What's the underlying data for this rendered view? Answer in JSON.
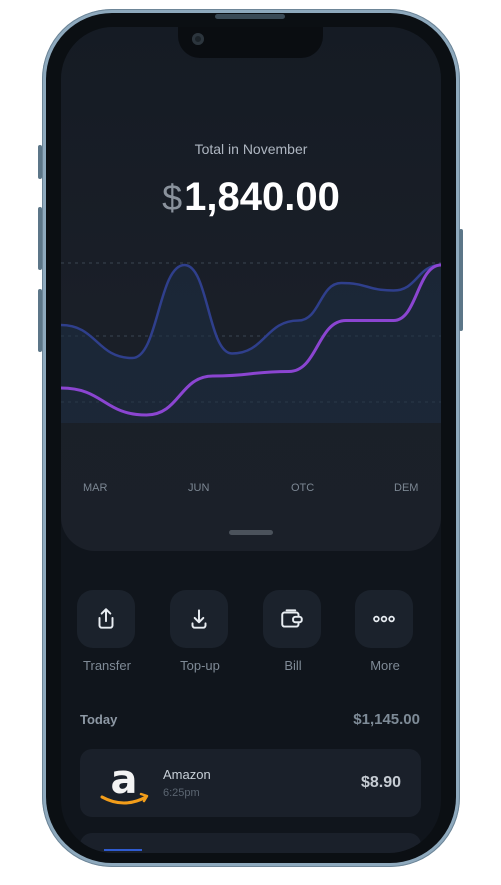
{
  "summary": {
    "label": "Total in November",
    "currency": "$",
    "amount": "1,840.00"
  },
  "chart_data": {
    "type": "line",
    "x_labels": [
      "MAR",
      "JUN",
      "OTC",
      "DEM"
    ],
    "series": [
      {
        "color": "#2f3f8c",
        "points": [
          {
            "x": 0,
            "y": 0.52
          },
          {
            "x": 1.5,
            "y": 0.3
          },
          {
            "x": 2.6,
            "y": 0.92
          },
          {
            "x": 3.6,
            "y": 0.33
          },
          {
            "x": 5.0,
            "y": 0.55
          },
          {
            "x": 5.9,
            "y": 0.8
          },
          {
            "x": 7.0,
            "y": 0.75
          },
          {
            "x": 8.0,
            "y": 0.92
          }
        ]
      },
      {
        "color": "#8b45d1",
        "points": [
          {
            "x": 0,
            "y": 0.1
          },
          {
            "x": 1.8,
            "y": -0.08
          },
          {
            "x": 3.2,
            "y": 0.18
          },
          {
            "x": 4.8,
            "y": 0.21
          },
          {
            "x": 6.0,
            "y": 0.55
          },
          {
            "x": 7.0,
            "y": 0.55
          },
          {
            "x": 8.0,
            "y": 0.92
          }
        ]
      }
    ],
    "colors": {
      "grid": "#3a4552",
      "area": "#1d2d44"
    }
  },
  "actions": [
    {
      "label": "Transfer",
      "icon": "share-up-icon"
    },
    {
      "label": "Top-up",
      "icon": "download-icon"
    },
    {
      "label": "Bill",
      "icon": "wallet-icon"
    },
    {
      "label": "More",
      "icon": "more-dots-icon"
    }
  ],
  "today": {
    "label": "Today",
    "total": "$1,145.00"
  },
  "transactions": [
    {
      "merchant": "Amazon",
      "time": "6:25pm",
      "amount": "$8.90",
      "logo": "amazon-logo"
    }
  ]
}
